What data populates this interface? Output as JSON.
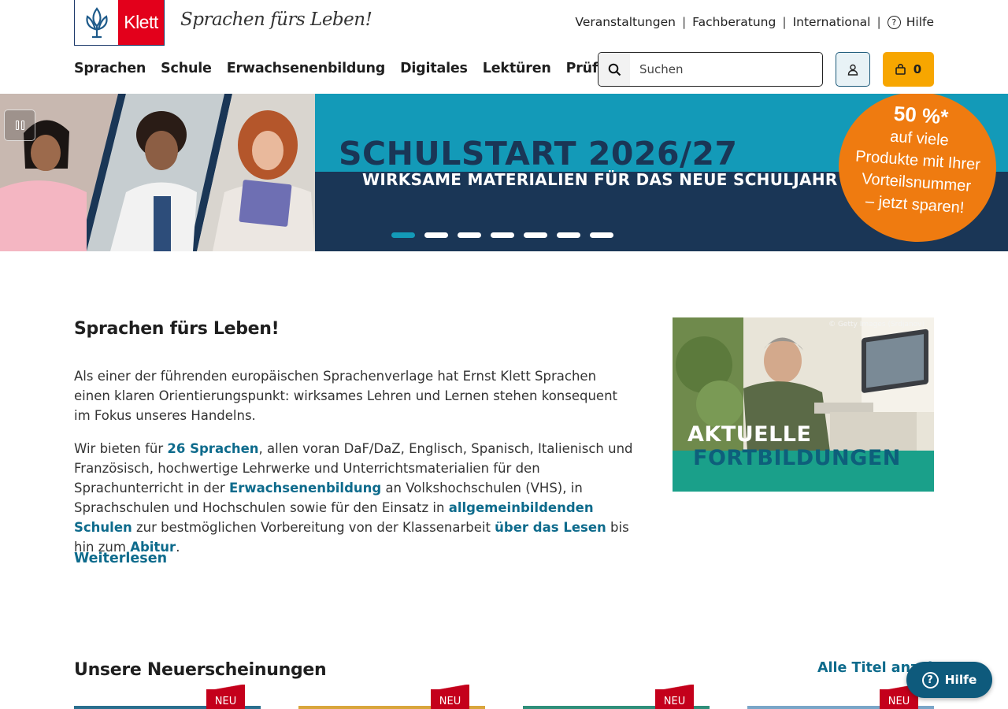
{
  "header": {
    "brand": "Klett",
    "slogan": "Sprachen fürs Leben!",
    "topnav": [
      "Veranstaltungen",
      "Fachberatung",
      "International",
      "Hilfe"
    ],
    "mainnav": [
      "Sprachen",
      "Schule",
      "Erwachsenenbildung",
      "Digitales",
      "Lektüren",
      "Prüfungen"
    ],
    "search_placeholder": "Suchen",
    "cart_count": "0"
  },
  "banner": {
    "title": "SCHULSTART 2026/27",
    "subtitle": "WIRKSAME MATERIALIEN FÜR DAS NEUE SCHULJAHR",
    "offer_percent": "50 %*",
    "offer_lines": [
      "auf viele",
      "Produkte mit Ihrer",
      "Vorteilsnummer",
      "– jetzt sparen!"
    ],
    "slide_count": 7,
    "active_slide": 1
  },
  "intro": {
    "heading": "Sprachen fürs Leben!",
    "p1": "Als einer der führenden europäischen Sprachenverlage hat Ernst Klett Sprachen einen klaren Orientierungspunkt: wirksames Lehren und Lernen stehen konsequent im Fokus unseres Handelns.",
    "p2_a": "Wir bieten für ",
    "link_languages": "26 Sprachen",
    "p2_b": ", allen voran DaF/DaZ, Englisch, Spanisch, Italienisch und Französisch, hochwertige Lehrwerke und Unterrichtsmaterialien für den Sprachunterricht in der ",
    "link_adult": "Erwachsenenbildung",
    "p2_c": " an Volkshochschulen (VHS), in Sprachschulen und Hochschulen sowie für den Einsatz in ",
    "link_schools": "allgemeinbildenden Schulen",
    "p2_d": " zur bestmöglichen Vorbereitung von der Klassenarbeit ",
    "link_reading": "über das Lesen",
    "p2_e": " bis hin zum ",
    "link_abitur": "Abitur",
    "p2_f": ".",
    "more": "Weiterlesen"
  },
  "promo": {
    "line1": "AKTUELLE",
    "line2": "FORTBILDUNGEN",
    "copyright": "© Getty Images (Srdjanov)"
  },
  "new_releases": {
    "heading": "Unsere Neuerscheinungen",
    "all_titles": "Alle Titel anzeigen",
    "badge": "NEU",
    "card_colors": [
      "#2a6f8e",
      "#d9a63c",
      "#2f8f7a",
      "#7aa6c8"
    ]
  },
  "help_fab": "Hilfe"
}
